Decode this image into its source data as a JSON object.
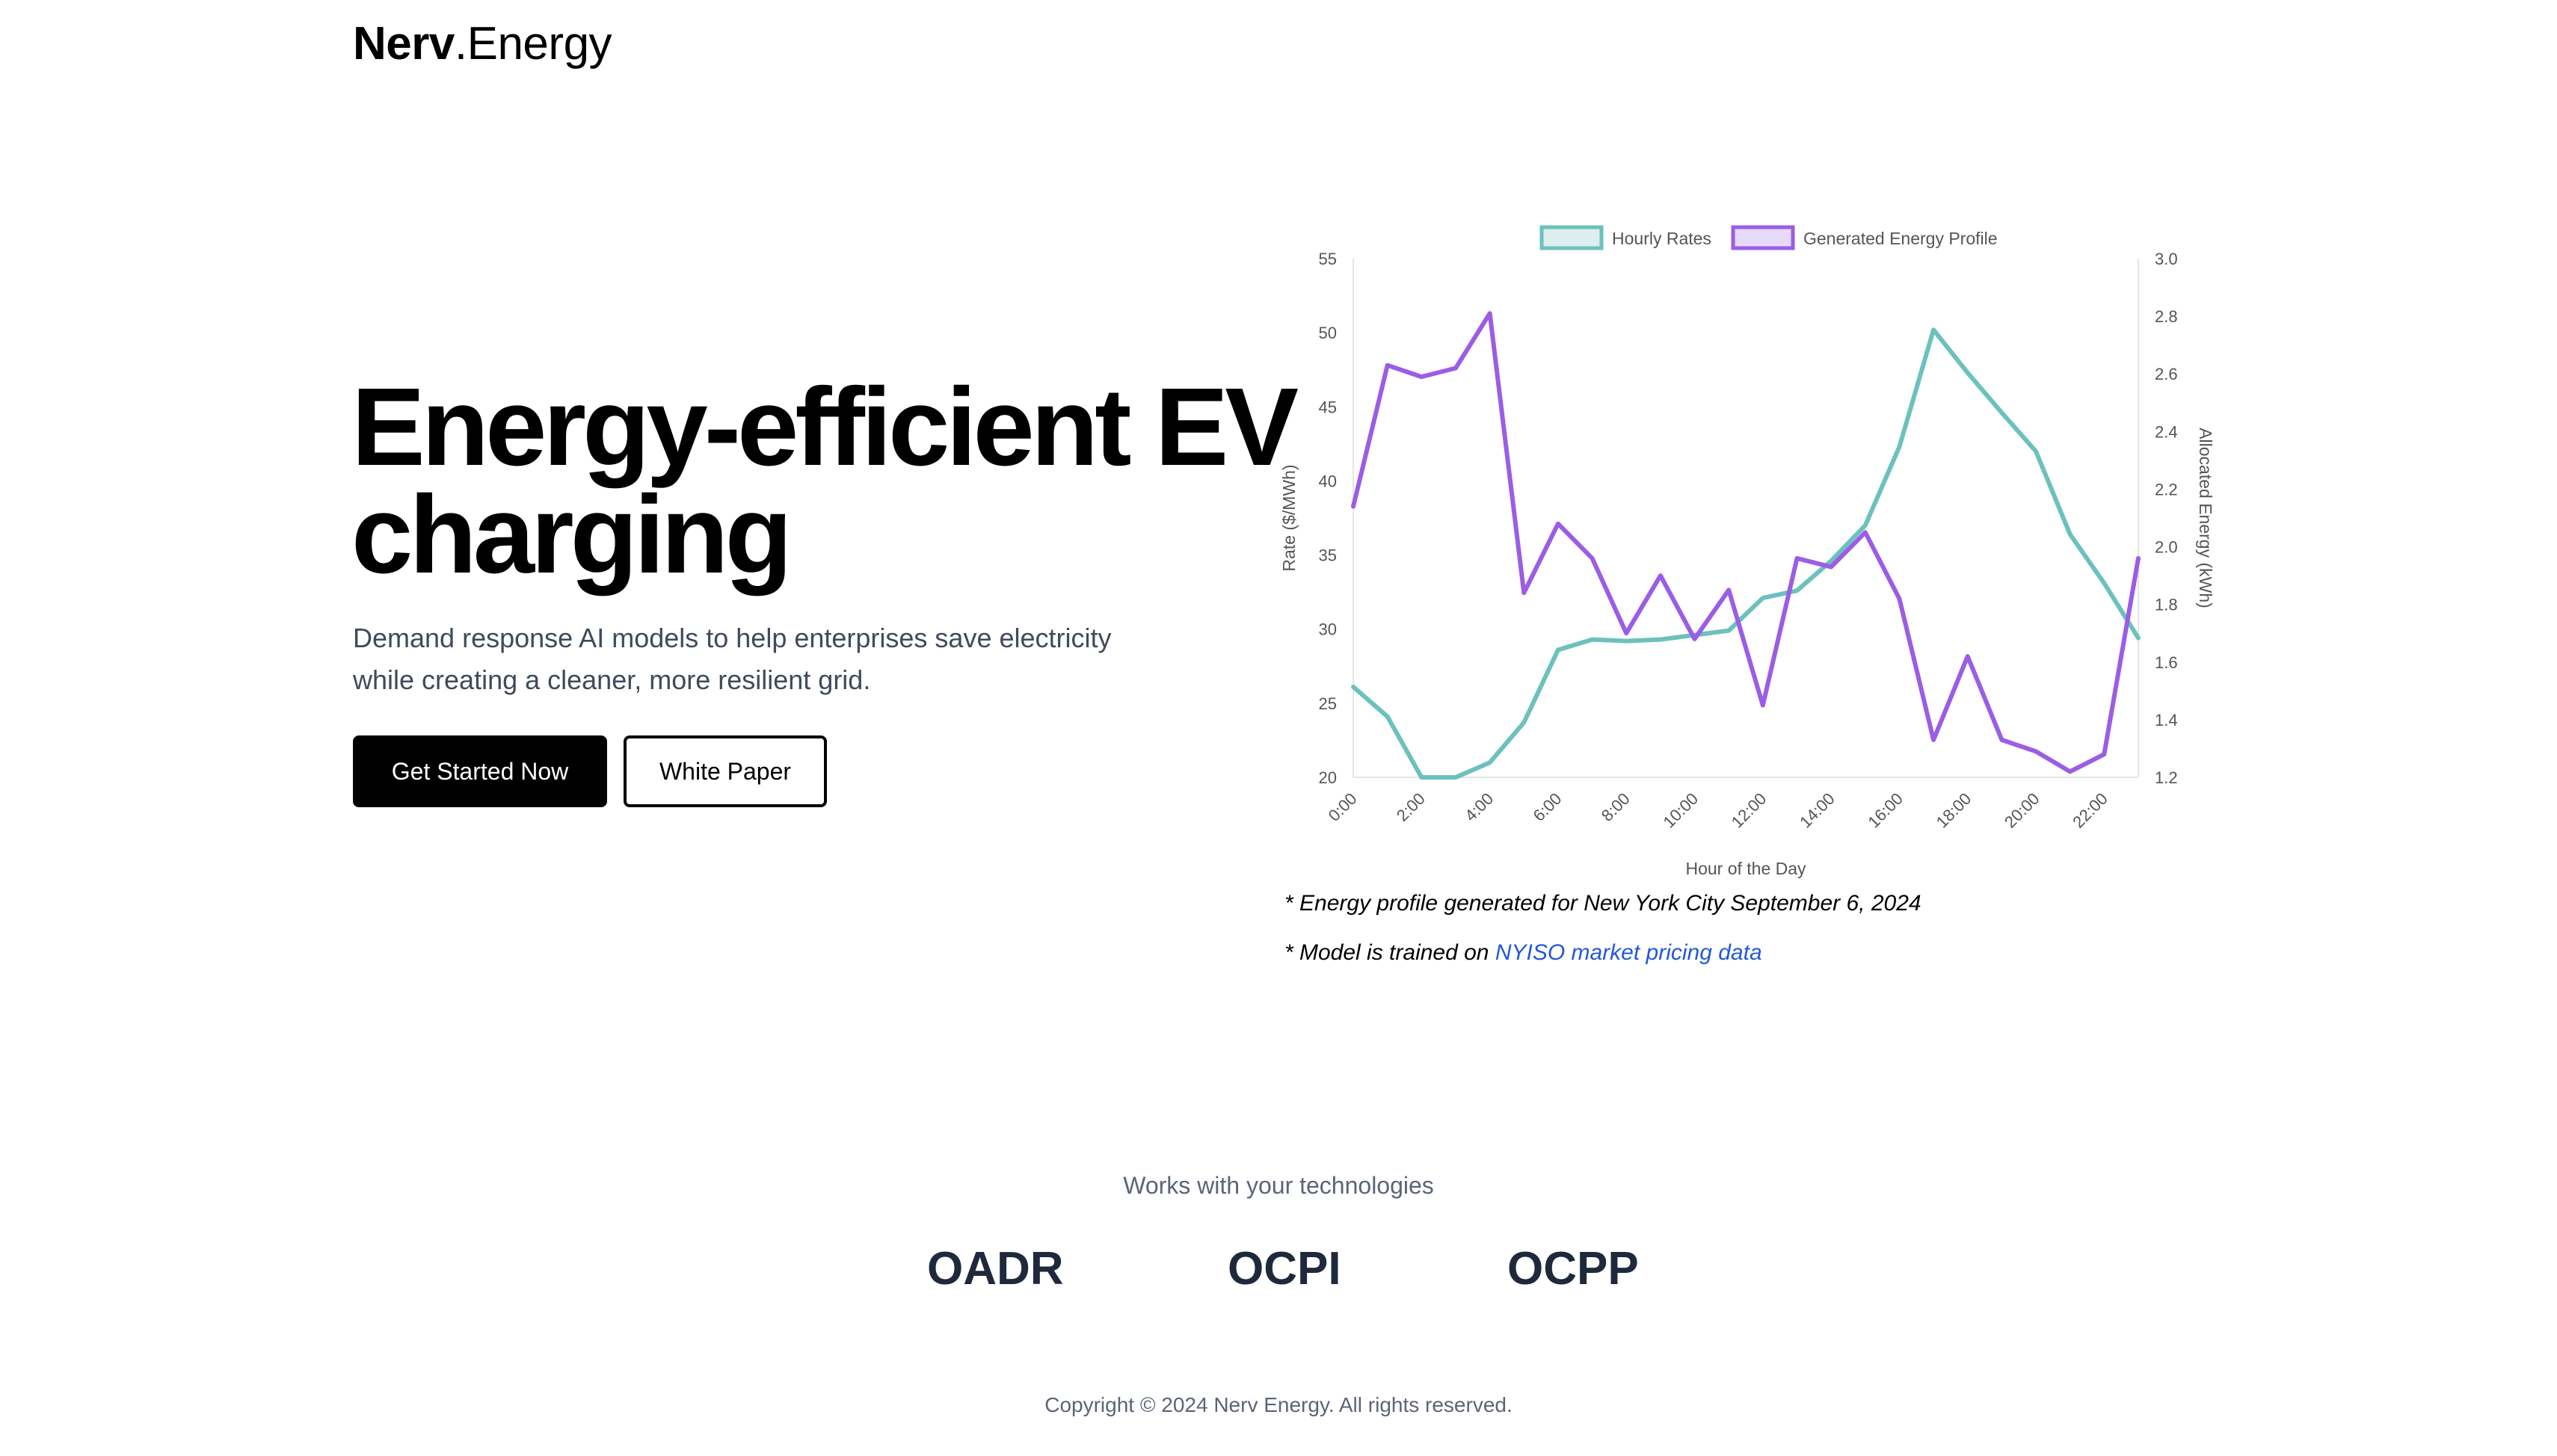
{
  "header": {
    "logo_bold": "Nerv",
    "logo_rest": ".Energy"
  },
  "hero": {
    "title_line1": "Energy-efficient EV",
    "title_line2": "charging",
    "subtitle_line1": "Demand response AI models to help enterprises save electricity",
    "subtitle_line2": "while creating a cleaner, more resilient grid.",
    "primary_button": "Get Started Now",
    "secondary_button": "White Paper"
  },
  "chart_data": {
    "type": "line",
    "xlabel": "Hour of the Day",
    "ylabel_left": "Rate ($/MWh)",
    "ylabel_right": "Allocated Energy (kWh)",
    "x": [
      "0:00",
      "1:00",
      "2:00",
      "3:00",
      "4:00",
      "5:00",
      "6:00",
      "7:00",
      "8:00",
      "9:00",
      "10:00",
      "11:00",
      "12:00",
      "13:00",
      "14:00",
      "15:00",
      "16:00",
      "17:00",
      "18:00",
      "19:00",
      "20:00",
      "21:00",
      "22:00",
      "23:00"
    ],
    "x_tick_labels": [
      "0:00",
      "2:00",
      "4:00",
      "6:00",
      "8:00",
      "10:00",
      "12:00",
      "14:00",
      "16:00",
      "18:00",
      "20:00",
      "22:00"
    ],
    "ylim_left": [
      20,
      55
    ],
    "ylim_right": [
      1.2,
      3.0
    ],
    "yticks_left": [
      "55",
      "50",
      "45",
      "40",
      "35",
      "30",
      "25",
      "20"
    ],
    "yticks_right": [
      "3.0",
      "2.8",
      "2.6",
      "2.4",
      "2.2",
      "2.0",
      "1.8",
      "1.6",
      "1.4",
      "1.2"
    ],
    "legend_position": "top",
    "grid": false,
    "series": [
      {
        "name": "Hourly Rates",
        "axis": "left",
        "color": "#6cc1bd",
        "fill": "#dceeed",
        "values": [
          26.1,
          24.1,
          20.0,
          20.0,
          21.0,
          23.7,
          28.6,
          29.3,
          29.2,
          29.3,
          29.6,
          29.9,
          32.1,
          32.6,
          34.6,
          37.0,
          42.3,
          50.2,
          47.3,
          44.6,
          42.0,
          36.4,
          33.1,
          29.4
        ]
      },
      {
        "name": "Generated Energy Profile",
        "axis": "right",
        "color": "#9b5de5",
        "fill": "#e5daf9",
        "values": [
          2.14,
          2.63,
          2.59,
          2.62,
          2.81,
          1.84,
          2.08,
          1.96,
          1.7,
          1.9,
          1.68,
          1.85,
          1.45,
          1.96,
          1.93,
          2.05,
          1.82,
          1.33,
          1.62,
          1.33,
          1.29,
          1.22,
          1.28,
          1.96
        ]
      }
    ]
  },
  "notes": {
    "note1": "* Energy profile generated for New York City September 6, 2024",
    "note2_prefix": "* Model is trained on ",
    "note2_link": "NYISO market pricing data"
  },
  "tech": {
    "label": "Works with your technologies",
    "items": [
      "OADR",
      "OCPI",
      "OCPP"
    ]
  },
  "footer": {
    "copyright": "Copyright © 2024 Nerv Energy. All rights reserved."
  }
}
